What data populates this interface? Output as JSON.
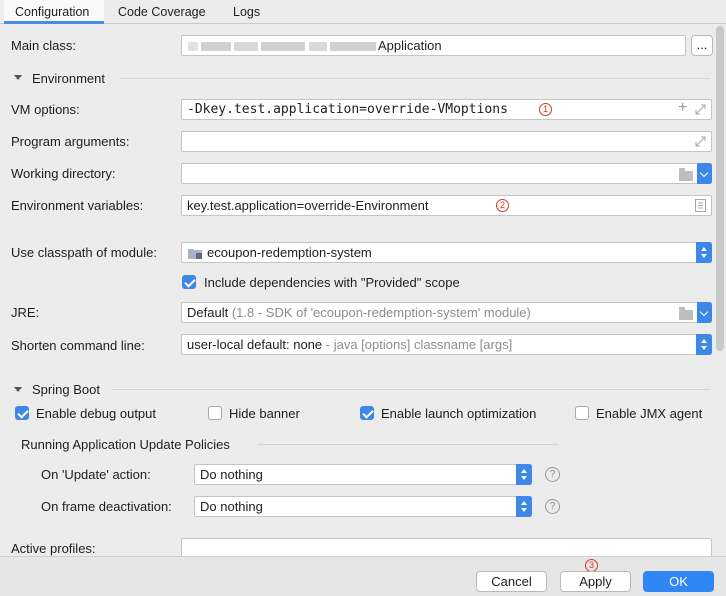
{
  "tabs": [
    {
      "label": "Configuration"
    },
    {
      "label": "Code Coverage"
    },
    {
      "label": "Logs"
    }
  ],
  "main_class": {
    "label": "Main class:",
    "value": "Application",
    "browse": "..."
  },
  "environment": {
    "title": "Environment",
    "vm_options_label": "VM options:",
    "vm_options_value": "-Dkey.test.application=override-VMoptions",
    "program_arguments_label": "Program arguments:",
    "program_arguments_value": "",
    "working_directory_label": "Working directory:",
    "working_directory_value": "",
    "env_vars_label": "Environment variables:",
    "env_vars_value": "key.test.application=override-Environment"
  },
  "classpath": {
    "label": "Use classpath of module:",
    "value": "ecoupon-redemption-system",
    "include_deps_label": "Include dependencies with \"Provided\" scope",
    "include_deps_checked": true
  },
  "jre": {
    "label": "JRE:",
    "value": "Default",
    "hint": "(1.8 - SDK of 'ecoupon-redemption-system' module)"
  },
  "shorten": {
    "label": "Shorten command line:",
    "value": "user-local default: none",
    "hint": "- java [options] classname [args]"
  },
  "spring_boot": {
    "title": "Spring Boot",
    "enable_debug_label": "Enable debug output",
    "enable_debug_checked": true,
    "hide_banner_label": "Hide banner",
    "hide_banner_checked": false,
    "launch_opt_label": "Enable launch optimization",
    "launch_opt_checked": true,
    "jmx_label": "Enable JMX agent",
    "jmx_checked": false
  },
  "policies": {
    "title": "Running Application Update Policies",
    "update_label": "On 'Update' action:",
    "update_value": "Do nothing",
    "frame_label": "On frame deactivation:",
    "frame_value": "Do nothing",
    "help": "?"
  },
  "active_profiles": {
    "label": "Active profiles:",
    "value": ""
  },
  "annotations": [
    "1",
    "2",
    "3"
  ],
  "buttons": {
    "cancel": "Cancel",
    "apply": "Apply",
    "ok": "OK"
  },
  "colors": {
    "accent": "#3d87e6",
    "annotation": "#d43a2a",
    "background": "#ececec"
  }
}
